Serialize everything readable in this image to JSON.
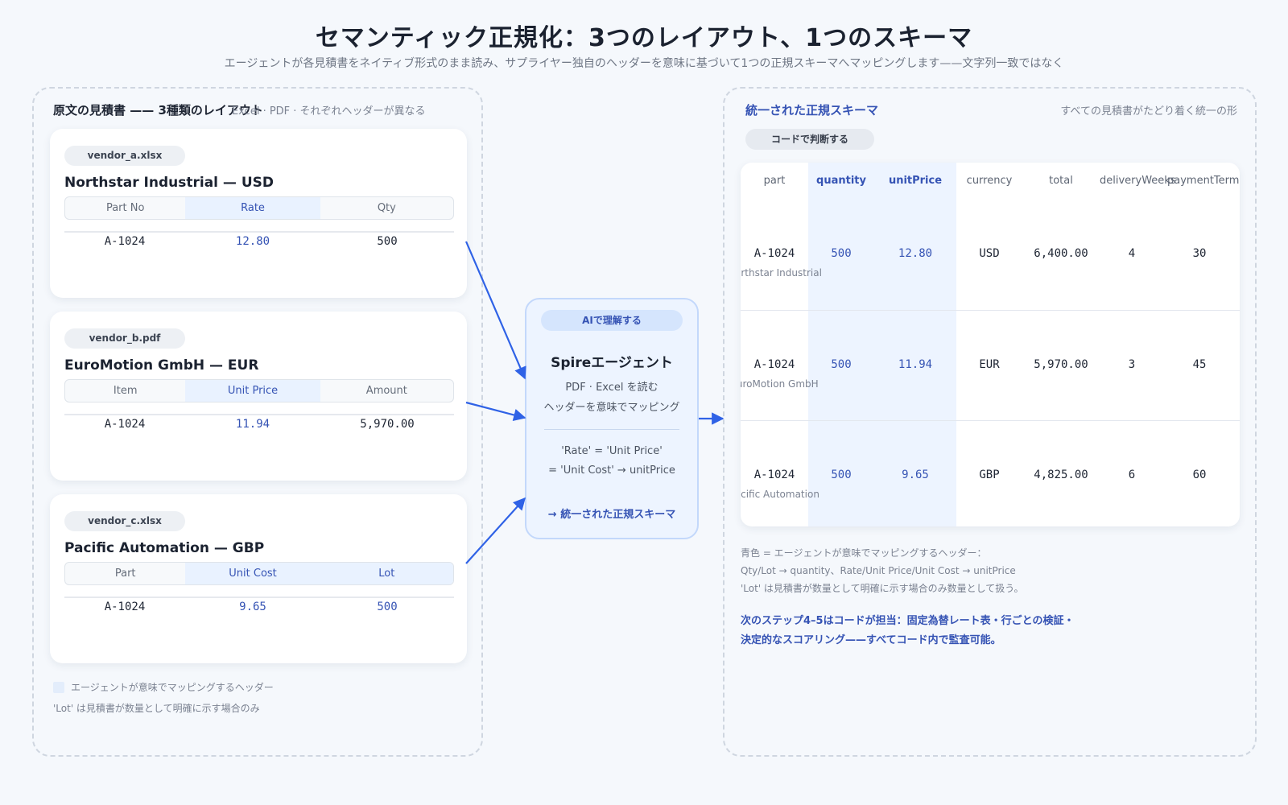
{
  "header": {
    "title": "セマンティック正規化：3つのレイアウト、1つのスキーマ",
    "subtitle": "エージェントが各見積書をネイティブ形式のまま読み、サプライヤー独自のヘッダーを意味に基づいて1つの正規スキーマへマッピングします——文字列一致ではなく"
  },
  "left_panel": {
    "title": "原文の見積書 —— 3種類のレイアウト",
    "note": "Excel · PDF · それぞれヘッダーが異なる",
    "cards": [
      {
        "file": "vendor_a.xlsx",
        "title": "Northstar Industrial — USD",
        "headers": [
          "Part No",
          "Rate",
          "Qty"
        ],
        "values": [
          "A-1024",
          "12.80",
          "500"
        ]
      },
      {
        "file": "vendor_b.pdf",
        "title": "EuroMotion GmbH — EUR",
        "headers": [
          "Item",
          "Unit Price",
          "Amount"
        ],
        "values": [
          "A-1024",
          "11.94",
          "5,970.00"
        ]
      },
      {
        "file": "vendor_c.xlsx",
        "title": "Pacific Automation — GBP",
        "headers": [
          "Part",
          "Unit Cost",
          "Lot"
        ],
        "values": [
          "A-1024",
          "9.65",
          "500"
        ]
      }
    ],
    "legend": "エージェントが意味でマッピングするヘッダー",
    "legend_note": "'Lot' は見積書が数量として明確に示す場合のみ"
  },
  "agent": {
    "badge": "AIで理解する",
    "title": "Spireエージェント",
    "line1": "PDF · Excel を読む",
    "line2": "ヘッダーを意味でマッピング",
    "map1": "'Rate' = 'Unit Price'",
    "map2": "= 'Unit Cost' → unitPrice",
    "result": "→ 統一された正規スキーマ"
  },
  "right_panel": {
    "title": "統一された正規スキーマ",
    "note": "すべての見積書がたどり着く統一の形",
    "code_badge": "コードで判断する",
    "columns": [
      "part",
      "quantity",
      "unitPrice",
      "currency",
      "total",
      "deliveryWeeks",
      "paymentTerms"
    ],
    "rows": [
      {
        "part": "A-1024",
        "vendor": "Northstar Industrial",
        "quantity": "500",
        "unitPrice": "12.80",
        "currency": "USD",
        "total": "6,400.00",
        "deliveryWeeks": "4",
        "paymentTerms": "30"
      },
      {
        "part": "A-1024",
        "vendor": "EuroMotion GmbH",
        "quantity": "500",
        "unitPrice": "11.94",
        "currency": "EUR",
        "total": "5,970.00",
        "deliveryWeeks": "3",
        "paymentTerms": "45"
      },
      {
        "part": "A-1024",
        "vendor": "Pacific Automation",
        "quantity": "500",
        "unitPrice": "9.65",
        "currency": "GBP",
        "total": "4,825.00",
        "deliveryWeeks": "6",
        "paymentTerms": "60"
      }
    ],
    "note1": "青色 = エージェントが意味でマッピングするヘッダー：",
    "note2": "Qty/Lot → quantity、Rate/Unit Price/Unit Cost → unitPrice",
    "note3": "'Lot' は見積書が数量として明確に示す場合のみ数量として扱う。",
    "step1": "次のステップ4–5はコードが担当：固定為替レート表・行ごとの検証・",
    "step2": "決定的なスコアリング——すべてコード内で監査可能。"
  },
  "colors": {
    "accent": "#2f62e6",
    "mapped_bg": "#e9f2ff",
    "mapped_text": "#3553b4"
  }
}
